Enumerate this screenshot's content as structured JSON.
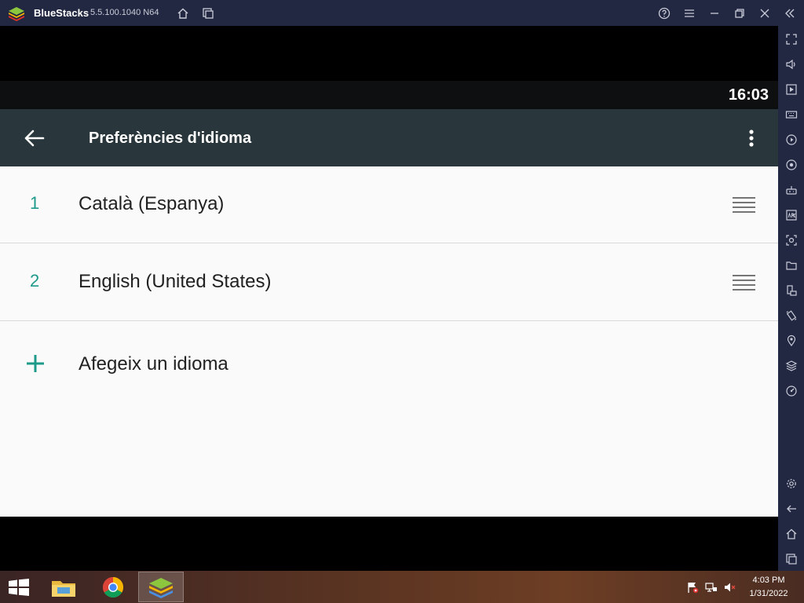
{
  "window": {
    "app_name": "BlueStacks",
    "version": "5.5.100.1040 N64",
    "controls": [
      "help-icon",
      "menu-icon",
      "minimize-icon",
      "restore-icon",
      "close-icon",
      "collapse-sidebar-icon"
    ],
    "nav_icons": [
      "home-icon",
      "multi-instance-icon"
    ]
  },
  "sidebar": {
    "top_items": [
      "fullscreen-icon",
      "volume-icon",
      "media-manager-icon",
      "keyboard-icon",
      "macro-icon",
      "record-icon",
      "game-controls-icon",
      "install-apk-icon",
      "screenshot-icon",
      "folder-icon",
      "rotate-icon",
      "shake-icon",
      "location-icon",
      "multi-instance-icon",
      "eco-mode-icon"
    ],
    "bottom_items": [
      "settings-icon",
      "back-icon",
      "home-icon",
      "recent-apps-icon"
    ]
  },
  "status_bar": {
    "time": "16:03"
  },
  "app_bar": {
    "title": "Preferències d'idioma"
  },
  "languages": [
    {
      "index": "1",
      "name": "Català (Espanya)"
    },
    {
      "index": "2",
      "name": "English (United States)"
    }
  ],
  "add_language": {
    "label": "Afegeix un idioma"
  },
  "taskbar": {
    "apps": [
      "file-explorer-icon",
      "chrome-icon",
      "bluestacks-icon"
    ],
    "active_app": "bluestacks-icon",
    "tray": [
      "action-center-flag-icon",
      "network-icon",
      "volume-muted-icon"
    ],
    "time": "4:03 PM",
    "date": "1/31/2022"
  },
  "colors": {
    "titlebar": "#232842",
    "app_bar": "#29363b",
    "accent": "#1e9a8a",
    "content_bg": "#fafafa"
  }
}
